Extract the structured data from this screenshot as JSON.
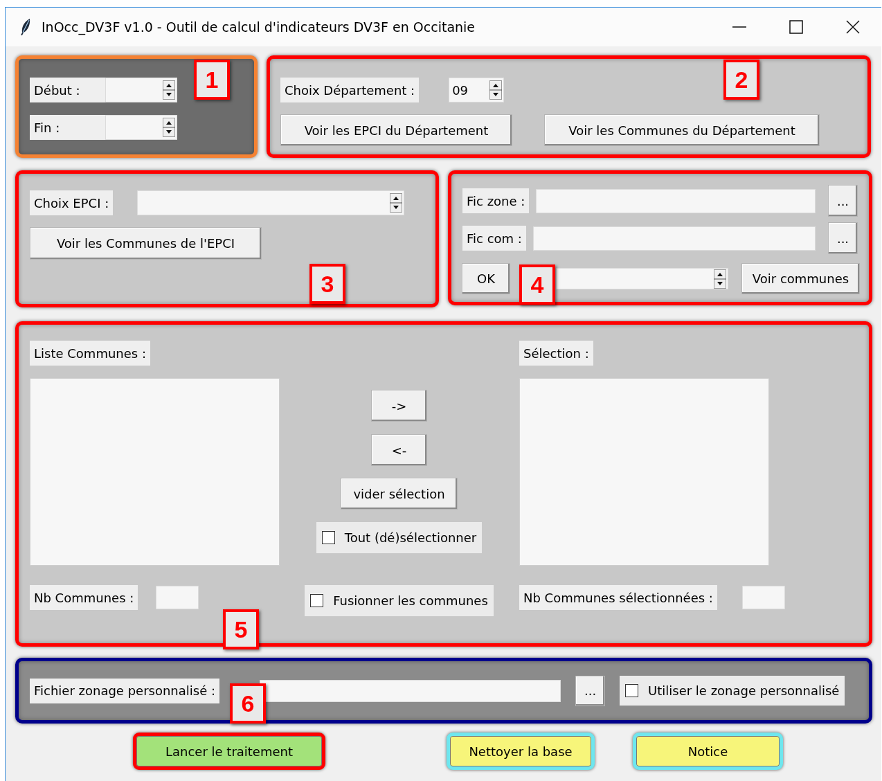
{
  "window": {
    "title": "InOcc_DV3F v1.0 - Outil de calcul d'indicateurs DV3F en Occitanie"
  },
  "period": {
    "badge": "1",
    "color": "#f58233",
    "kind": "dark",
    "start_label": "Début :",
    "end_label": "Fin :"
  },
  "department": {
    "badge": "2",
    "color": "#ff0000",
    "kind": "light",
    "label": "Choix Département :",
    "value": "09",
    "buttons": [
      "Voir les EPCI du Département",
      "Voir les Communes du Département"
    ]
  },
  "epci": {
    "badge": "3",
    "color": "#ff0000",
    "kind": "light",
    "label": "Choix EPCI :",
    "button": "Voir les Communes de l'EPCI"
  },
  "files": {
    "badge": "4",
    "color": "#ff0000",
    "kind": "light",
    "zone_label": "Fic zone :",
    "zone_browse": "...",
    "com_label": "Fic com :",
    "com_browse": "...",
    "ok_button": "OK",
    "view_button": "Voir communes"
  },
  "communes": {
    "badge": "5",
    "color": "#ff0000",
    "kind": "light",
    "list_label": "Liste Communes :",
    "selection_label": "Sélection :",
    "add_button": "->",
    "remove_button": "<-",
    "clear_button": "vider sélection",
    "select_all": {
      "label": "Tout (dé)sélectionner",
      "checked": false
    },
    "count_label": "Nb Communes :",
    "merge": {
      "label": "Fusionner les communes",
      "checked": false
    },
    "selected_count_label": "Nb Communes sélectionnées :"
  },
  "custom_zoning": {
    "badge": "6",
    "color": "#00008b",
    "kind": "medium",
    "label": "Fichier zonage personnalisé :",
    "browse": "...",
    "use": {
      "label": "Utiliser le zonage personnalisé",
      "checked": false
    }
  },
  "actions": [
    {
      "label": "Lancer le traitement",
      "color": "#a3e27a",
      "kind": "primary"
    },
    {
      "label": "Nettoyer la base",
      "color": "#f7f57a",
      "kind": "secondary"
    },
    {
      "label": "Notice",
      "color": "#f7f57a",
      "kind": "secondary"
    }
  ]
}
